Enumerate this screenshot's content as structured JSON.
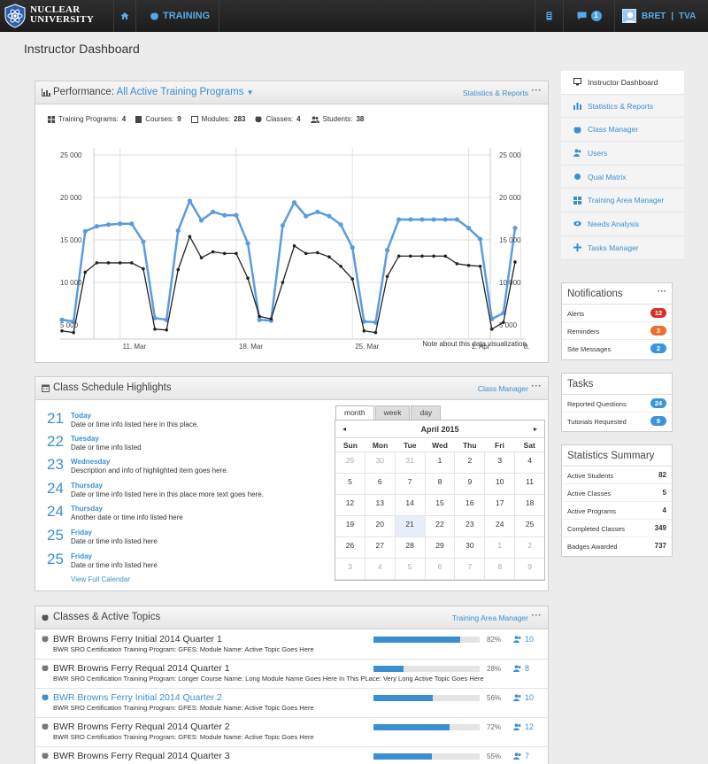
{
  "app": {
    "logo_line1": "NUCLEAR",
    "logo_line2": "UNIVERSITY",
    "nav_training": "TRAINING",
    "notifications_count": "1",
    "user_name": "BRET",
    "user_org": "TVA",
    "user_sep": "|"
  },
  "page_title": "Instructor Dashboard",
  "performance": {
    "title_prefix": "Performance:",
    "title_filter": "All Active Training Programs",
    "link": "Statistics  & Reports",
    "dots": "···",
    "stats": [
      {
        "label": "Training Programs:",
        "value": "4"
      },
      {
        "label": "Courses:",
        "value": "9"
      },
      {
        "label": "Modules:",
        "value": "283"
      },
      {
        "label": "Classes:",
        "value": "4"
      },
      {
        "label": "Students:",
        "value": "38"
      }
    ],
    "note": "Note about this data visualization."
  },
  "chart_data": {
    "type": "line",
    "x_labels": [
      "11. Mar",
      "18. Mar",
      "25. Mar",
      "1. Apr",
      "8."
    ],
    "y_ticks": [
      "25 000",
      "20 000",
      "15 000",
      "10 000",
      "5 000"
    ],
    "ylim": [
      5000,
      25000
    ],
    "grid": true,
    "series": [
      {
        "color": "#5b9be0",
        "values": [
          5600,
          5400,
          16000,
          16600,
          16800,
          16900,
          16900,
          14800,
          5800,
          5600,
          16100,
          19600,
          17300,
          18300,
          17900,
          17900,
          14600,
          5600,
          5500,
          16700,
          19400,
          17800,
          18300,
          17800,
          16800,
          14100,
          5400,
          5300,
          13800,
          17400,
          17400,
          17400,
          17400,
          17400,
          17400,
          16400,
          15100,
          5700,
          6400,
          16400
        ]
      },
      {
        "color": "#222222",
        "values": [
          4300,
          4100,
          11200,
          12300,
          12300,
          12300,
          12300,
          11600,
          4500,
          4400,
          11500,
          15400,
          12900,
          13600,
          13400,
          13400,
          10500,
          6000,
          5700,
          10000,
          14300,
          13400,
          13500,
          13000,
          11900,
          10400,
          4300,
          4100,
          10700,
          13100,
          13100,
          13100,
          13100,
          13100,
          12200,
          12000,
          11900,
          4500,
          5300,
          12400
        ]
      }
    ]
  },
  "schedule": {
    "title": "Class Schedule Highlights",
    "link": "Class Manager",
    "dots": "···",
    "items": [
      {
        "num": "21",
        "day": "Today",
        "desc": "Date or time info listed here in this place."
      },
      {
        "num": "22",
        "day": "Tuesday",
        "desc": "Date or time info listed"
      },
      {
        "num": "23",
        "day": "Wednesday",
        "desc": "Description and info of highlighted item goes here."
      },
      {
        "num": "24",
        "day": "Thursday",
        "desc": "Date or time info listed here in this place more text goes here."
      },
      {
        "num": "24",
        "day": "Thursday",
        "desc": "Another date or time info listed here"
      },
      {
        "num": "25",
        "day": "Friday",
        "desc": "Date or time info listed here"
      },
      {
        "num": "25",
        "day": "Friday",
        "desc": "Date or time info listed here"
      }
    ],
    "view_full": "View Full Calendar",
    "calendar": {
      "tabs": [
        "month",
        "week",
        "day"
      ],
      "month_title": "April 2015",
      "prev": "◂",
      "next": "▸",
      "dow": [
        "Sun",
        "Mon",
        "Tue",
        "Wed",
        "Thu",
        "Fri",
        "Sat"
      ],
      "weeks": [
        [
          "29",
          "30",
          "31",
          "1",
          "2",
          "3",
          "4"
        ],
        [
          "5",
          "6",
          "7",
          "8",
          "9",
          "10",
          "11"
        ],
        [
          "12",
          "13",
          "14",
          "15",
          "16",
          "17",
          "18"
        ],
        [
          "19",
          "20",
          "21",
          "22",
          "23",
          "24",
          "25"
        ],
        [
          "26",
          "27",
          "28",
          "29",
          "30",
          "1",
          "2"
        ],
        [
          "3",
          "4",
          "5",
          "6",
          "7",
          "8",
          "9"
        ]
      ]
    }
  },
  "classes": {
    "title": "Classes & Active Topics",
    "link": "Training Area Manager",
    "dots": "···",
    "rows": [
      {
        "name": "BWR Browns Ferry Initial 2014 Quarter 1",
        "sub": "BWR SRO Certification Training Program:  GFES:  Module Name:  Active Topic Goes Here",
        "pct_label": "82%",
        "pct": 82,
        "count": "10",
        "highlight": false
      },
      {
        "name": "BWR Browns Ferry Requal 2014 Quarter 1",
        "sub": "BWR SRO Certification Training Program:  Longer Course Name:  Long Module Name Goes Here In This PLace:  Very Long Active Topic Goes Here",
        "pct_label": "28%",
        "pct": 28,
        "count": "8",
        "highlight": false
      },
      {
        "name": "BWR Browns Ferry Initial 2014 Quarter 2",
        "sub": "BWR SRO Certification Training Program:  GFES:  Module Name:  Active Topic Goes Here",
        "pct_label": "56%",
        "pct": 56,
        "count": "10",
        "highlight": true
      },
      {
        "name": "BWR Browns Ferry Requal 2014 Quarter 2",
        "sub": "BWR SRO Certification Training Program:  GFES:  Module Name:  Active Topic Goes Here",
        "pct_label": "72%",
        "pct": 72,
        "count": "12",
        "highlight": false
      },
      {
        "name": "BWR Browns Ferry Requal 2014 Quarter 3",
        "sub": "",
        "pct_label": "55%",
        "pct": 55,
        "count": "7",
        "highlight": false
      }
    ]
  },
  "side_menu": [
    {
      "label": "Instructor Dashboard",
      "icon": "monitor-icon",
      "active": true
    },
    {
      "label": "Statistics & Reports",
      "icon": "chart-icon",
      "active": false
    },
    {
      "label": "Class Manager",
      "icon": "apple-icon",
      "active": false
    },
    {
      "label": "Users",
      "icon": "users-icon",
      "active": false
    },
    {
      "label": "Qual Matrix",
      "icon": "matrix-icon",
      "active": false
    },
    {
      "label": "Training Area Manager",
      "icon": "grid-icon",
      "active": false
    },
    {
      "label": "Needs Analysis",
      "icon": "eye-icon",
      "active": false
    },
    {
      "label": "Tasks Manager",
      "icon": "tasks-icon",
      "active": false
    }
  ],
  "notifications": {
    "title": "Notifications",
    "dots": "···",
    "rows": [
      {
        "label": "Alerts",
        "value": "12",
        "color": "#d9302c"
      },
      {
        "label": "Reminders",
        "value": "3",
        "color": "#ec6f2c"
      },
      {
        "label": "Site Messages",
        "value": "2",
        "color": "#3b95d9"
      }
    ]
  },
  "tasks": {
    "title": "Tasks",
    "rows": [
      {
        "label": "Reported Questions",
        "value": "24",
        "color": "#3b95d9"
      },
      {
        "label": "Tutorials Requested",
        "value": "9",
        "color": "#3b95d9"
      }
    ]
  },
  "statistics": {
    "title": "Statistics Summary",
    "rows": [
      {
        "label": "Active Students",
        "value": "82"
      },
      {
        "label": "Active Classes",
        "value": "5"
      },
      {
        "label": "Active Programs",
        "value": "4"
      },
      {
        "label": "Completed Classes",
        "value": "349"
      },
      {
        "label": "Badges Awarded",
        "value": "737"
      }
    ]
  }
}
